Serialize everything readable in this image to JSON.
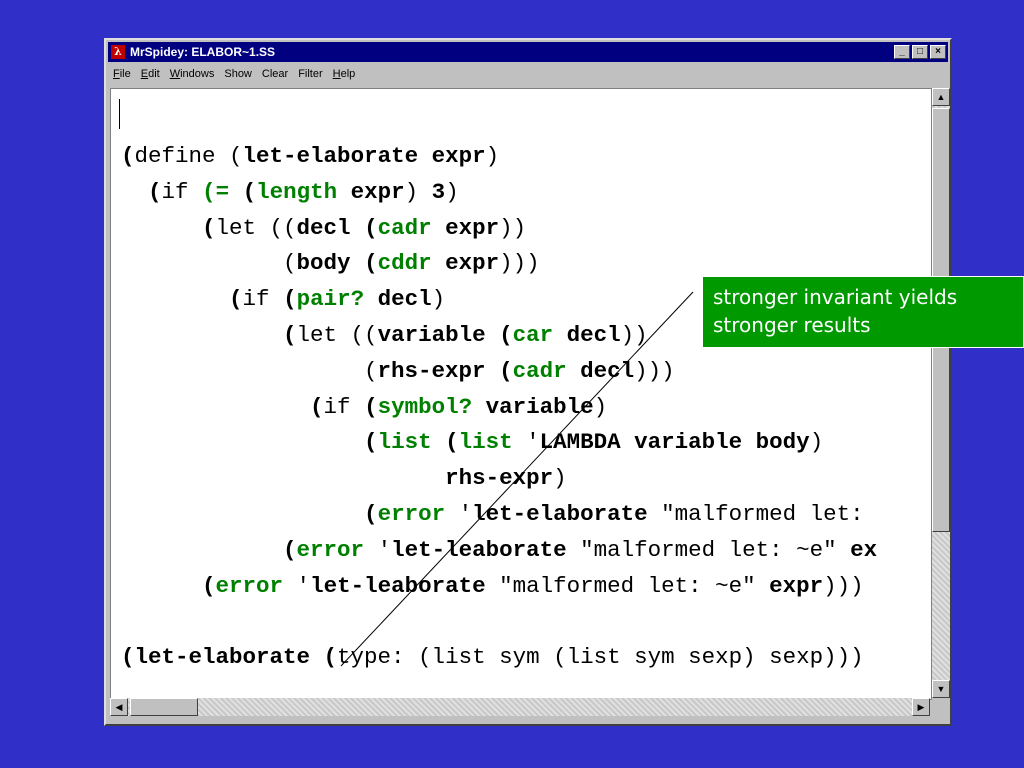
{
  "window": {
    "title": "MrSpidey: ELABOR~1.SS",
    "app_icon": "lambda-icon",
    "buttons": {
      "minimize": "_",
      "maximize": "□",
      "close": "×"
    }
  },
  "menu": {
    "items": [
      {
        "mnemonic": "F",
        "rest": "ile"
      },
      {
        "mnemonic": "E",
        "rest": "dit"
      },
      {
        "mnemonic": "W",
        "rest": "indows"
      },
      {
        "mnemonic": "",
        "rest": "Show"
      },
      {
        "mnemonic": "",
        "rest": "Clear"
      },
      {
        "mnemonic": "",
        "rest": "Filter"
      },
      {
        "mnemonic": "H",
        "rest": "elp"
      }
    ]
  },
  "code_lines": [
    [
      [
        "b",
        "("
      ],
      [
        "n",
        "define ("
      ],
      [
        "b",
        "let-elaborate expr"
      ],
      [
        "n",
        ")"
      ]
    ],
    [
      [
        "n",
        "  "
      ],
      [
        "b",
        "("
      ],
      [
        "n",
        "if "
      ],
      [
        "g",
        "("
      ],
      [
        "g",
        "="
      ],
      [
        "n",
        " "
      ],
      [
        "b",
        "("
      ],
      [
        "g",
        "length"
      ],
      [
        "n",
        " "
      ],
      [
        "b",
        "expr"
      ],
      [
        "n",
        ") "
      ],
      [
        "b",
        "3"
      ],
      [
        "n",
        ")"
      ]
    ],
    [
      [
        "n",
        "      "
      ],
      [
        "b",
        "("
      ],
      [
        "n",
        "let (("
      ],
      [
        "b",
        "decl"
      ],
      [
        "n",
        " "
      ],
      [
        "b",
        "("
      ],
      [
        "g",
        "cadr"
      ],
      [
        "n",
        " "
      ],
      [
        "b",
        "expr"
      ],
      [
        "n",
        "))"
      ]
    ],
    [
      [
        "n",
        "            ("
      ],
      [
        "b",
        "body"
      ],
      [
        "n",
        " "
      ],
      [
        "b",
        "("
      ],
      [
        "g",
        "cddr"
      ],
      [
        "n",
        " "
      ],
      [
        "b",
        "expr"
      ],
      [
        "n",
        ")))"
      ]
    ],
    [
      [
        "n",
        "        "
      ],
      [
        "b",
        "("
      ],
      [
        "n",
        "if "
      ],
      [
        "b",
        "("
      ],
      [
        "g",
        "pair?"
      ],
      [
        "n",
        " "
      ],
      [
        "b",
        "decl"
      ],
      [
        "n",
        ")"
      ]
    ],
    [
      [
        "n",
        "            "
      ],
      [
        "b",
        "("
      ],
      [
        "n",
        "let (("
      ],
      [
        "b",
        "variable"
      ],
      [
        "n",
        " "
      ],
      [
        "b",
        "("
      ],
      [
        "g",
        "car"
      ],
      [
        "n",
        " "
      ],
      [
        "b",
        "decl"
      ],
      [
        "n",
        "))"
      ]
    ],
    [
      [
        "n",
        "                  ("
      ],
      [
        "b",
        "rhs-expr"
      ],
      [
        "n",
        " "
      ],
      [
        "b",
        "("
      ],
      [
        "g",
        "cadr"
      ],
      [
        "n",
        " "
      ],
      [
        "b",
        "decl"
      ],
      [
        "n",
        ")))"
      ]
    ],
    [
      [
        "n",
        "              "
      ],
      [
        "b",
        "("
      ],
      [
        "n",
        "if "
      ],
      [
        "b",
        "("
      ],
      [
        "g",
        "symbol?"
      ],
      [
        "n",
        " "
      ],
      [
        "b",
        "variable"
      ],
      [
        "n",
        ")"
      ]
    ],
    [
      [
        "n",
        "                  "
      ],
      [
        "b",
        "("
      ],
      [
        "g",
        "list"
      ],
      [
        "n",
        " "
      ],
      [
        "b",
        "("
      ],
      [
        "g",
        "list"
      ],
      [
        "n",
        " '"
      ],
      [
        "b",
        "LAMBDA variable body"
      ],
      [
        "n",
        ")"
      ]
    ],
    [
      [
        "n",
        "                        "
      ],
      [
        "b",
        "rhs-expr"
      ],
      [
        "n",
        ")"
      ]
    ],
    [
      [
        "n",
        "                  "
      ],
      [
        "b",
        "("
      ],
      [
        "g",
        "error"
      ],
      [
        "n",
        " '"
      ],
      [
        "b",
        "let-elaborate"
      ],
      [
        "n",
        " \"malformed let: "
      ]
    ],
    [
      [
        "n",
        "            "
      ],
      [
        "b",
        "("
      ],
      [
        "g",
        "error"
      ],
      [
        "n",
        " '"
      ],
      [
        "b",
        "let-leaborate"
      ],
      [
        "n",
        " \"malformed let: ~e\" "
      ],
      [
        "b",
        "ex"
      ]
    ],
    [
      [
        "n",
        "      "
      ],
      [
        "b",
        "("
      ],
      [
        "g",
        "error"
      ],
      [
        "n",
        " '"
      ],
      [
        "b",
        "let-leaborate"
      ],
      [
        "n",
        " \"malformed let: ~e\" "
      ],
      [
        "b",
        "expr"
      ],
      [
        "n",
        ")))"
      ]
    ],
    [
      [
        "n",
        ""
      ]
    ],
    [
      [
        "b",
        "(let-elaborate ("
      ],
      [
        "n",
        "type: (list sym (list sym sexp) sexp)))"
      ]
    ]
  ],
  "callout": {
    "line1": "stronger invariant yields",
    "line2": "stronger results"
  },
  "colors": {
    "background": "#3030c8",
    "title_bar": "#000080",
    "keyword_green": "#008000",
    "callout_green": "#009900"
  }
}
